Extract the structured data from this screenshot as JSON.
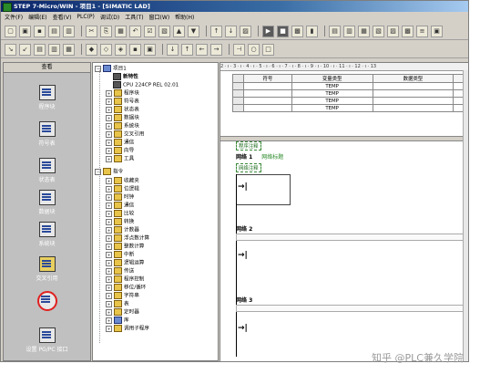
{
  "window": {
    "title": "STEP 7-Micro/WIN - 项目1 - [SIMATIC LAD]"
  },
  "menu": [
    "文件(F)",
    "编辑(E)",
    "查看(V)",
    "PLC(P)",
    "调试(D)",
    "工具(T)",
    "窗口(W)",
    "帮助(H)"
  ],
  "nav": {
    "title": "查看",
    "items": [
      {
        "label": "程序块",
        "icon": "program-block-icon"
      },
      {
        "label": "符号表",
        "icon": "symbol-table-icon"
      },
      {
        "label": "状态表",
        "icon": "status-table-icon"
      },
      {
        "label": "数据块",
        "icon": "data-block-icon"
      },
      {
        "label": "系统块",
        "icon": "system-block-icon"
      },
      {
        "label": "交叉引用",
        "icon": "cross-reference-icon"
      },
      {
        "label": "",
        "icon": "communication-icon"
      },
      {
        "label": "设置 PG/PC 接口",
        "icon": "pg-pc-interface-icon"
      }
    ]
  },
  "tree": {
    "project": "项目1",
    "new_feature": "新特性",
    "cpu": "CPU 224CP REL 02.01",
    "project_items": [
      "程序块",
      "符号表",
      "状态表",
      "数据块",
      "系统块",
      "交叉引用",
      "通信",
      "向导",
      "工具"
    ],
    "instructions_root": "指令",
    "instructions": [
      "收藏夹",
      "位逻辑",
      "时钟",
      "通信",
      "比较",
      "转换",
      "计数器",
      "浮点数计算",
      "整数计算",
      "中断",
      "逻辑运算",
      "传送",
      "程序控制",
      "移位/循环",
      "字符串",
      "表",
      "定时器",
      "库",
      "调用子程序"
    ]
  },
  "ruler": "2 · ı · 3 · ı · 4 · ı · 5 · ı · 6 · ı · 7 · ı · 8 · ı · 9 · ı · 10 · ı · 11 · ı · 12 · ı · 13",
  "var_table": {
    "headers": [
      "",
      "符号",
      "变量类型",
      "数据类型"
    ],
    "rows": [
      [
        "",
        "",
        "TEMP",
        ""
      ],
      [
        "",
        "",
        "TEMP",
        ""
      ],
      [
        "",
        "",
        "TEMP",
        ""
      ],
      [
        "",
        "",
        "TEMP",
        ""
      ]
    ]
  },
  "ladder": {
    "program_comment": "程序注释",
    "network1": "网络 1",
    "network1_title": "网络标题",
    "network_comment": "网络注释",
    "network2": "网络 2",
    "network3": "网络 3",
    "contact_symbol": "→|"
  },
  "watermark": "知乎 @PLC兼久学院"
}
